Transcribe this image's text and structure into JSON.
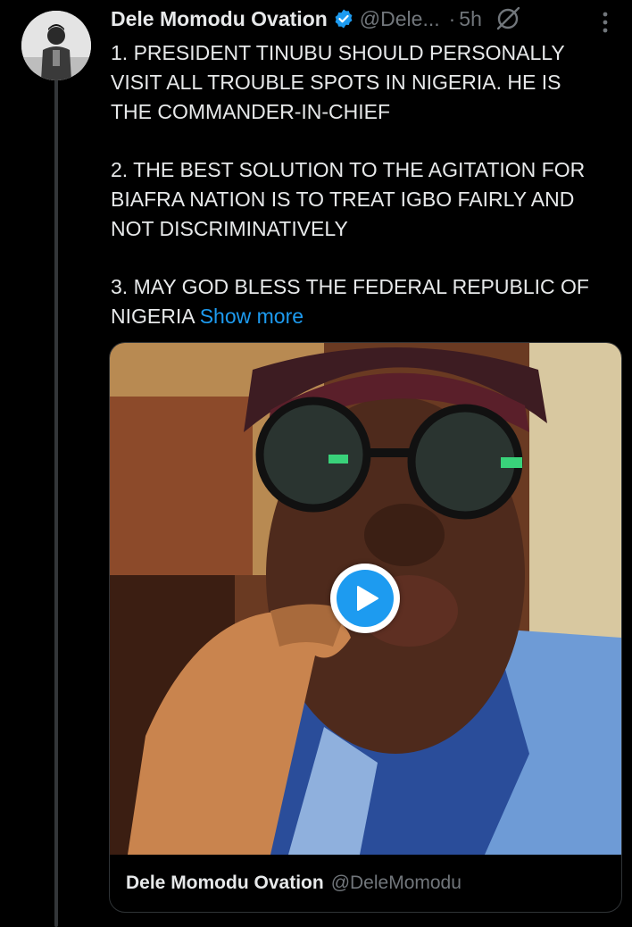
{
  "tweet": {
    "author_name": "Dele Momodu Ovation",
    "author_handle": "@Dele...",
    "separator": "·",
    "timestamp": "5h",
    "lines": {
      "p1a": "1. PRESIDENT TINUBU SHOULD PERSONALLY",
      "p1b": "VISIT ALL TROUBLE SPOTS IN NIGERIA. HE IS",
      "p1c": "THE COMMANDER-IN-CHIEF",
      "p2a": "2. THE BEST SOLUTION TO THE AGITATION FOR",
      "p2b": "BIAFRA NATION IS TO TREAT IGBO FAIRLY AND",
      "p2c": "NOT DISCRIMINATIVELY",
      "p3a": "3. MAY GOD BLESS THE FEDERAL REPUBLIC OF",
      "p3b": "NIGERIA"
    },
    "show_more": "Show more"
  },
  "media": {
    "footer_name": "Dele Momodu Ovation",
    "footer_handle": "@DeleMomodu"
  },
  "icons": {
    "verified": "verified-badge-icon",
    "grok": "grok-icon",
    "more": "more-vertical-icon",
    "play": "play-icon"
  },
  "colors": {
    "background": "#000000",
    "text": "#e7e9ea",
    "muted": "#71767b",
    "accent": "#1d9bf0"
  }
}
